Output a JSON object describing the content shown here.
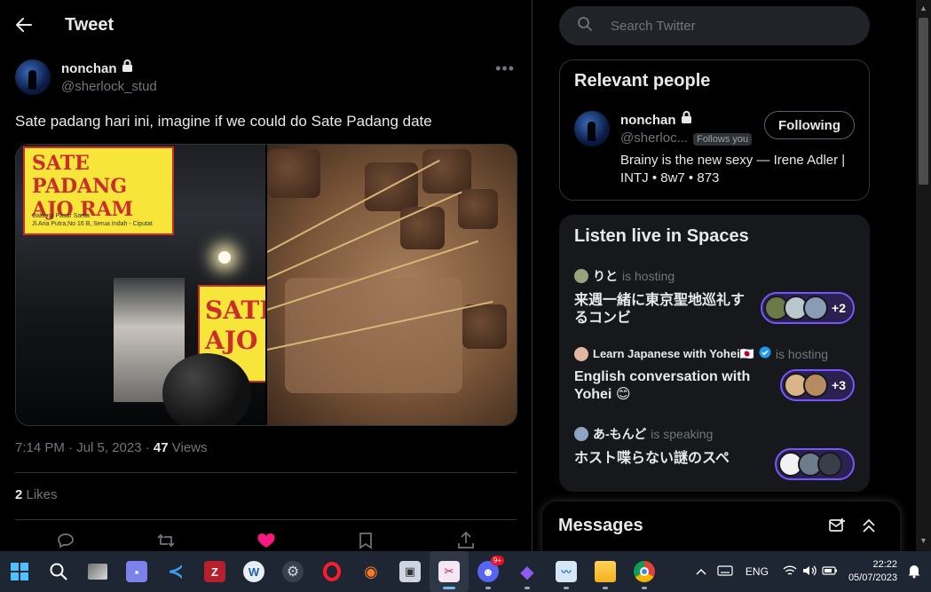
{
  "header": {
    "title": "Tweet"
  },
  "tweet": {
    "author_name": "nonchan",
    "author_handle": "@sherlock_stud",
    "text": "Sate padang hari ini, imagine if we could do Sate Padang date",
    "time": "7:14 PM · Jul 5, 2023 · ",
    "views_count": "47",
    "views_label": " Views",
    "likes_count": "2",
    "likes_label": " Likes",
    "media": [
      {
        "sign_line1": "SATE PADANG",
        "sign_line2": "AJO RAM",
        "sign_small1": "Cabang Pasar Santa",
        "sign_small2": "Jl.Aria Putra,No 16 B, Serua Indah - Ciputat",
        "sign2_text": "SATE AJO"
      },
      {}
    ]
  },
  "search": {
    "placeholder": "Search Twitter"
  },
  "relevant": {
    "title": "Relevant people",
    "name": "nonchan",
    "handle": "@sherloc...",
    "follows_you": "Follows you",
    "button": "Following",
    "bio": "Brainy is the new sexy — Irene Adler | INTJ • 8w7 • 873"
  },
  "spaces": {
    "title": "Listen live in Spaces",
    "items": [
      {
        "host": "りと",
        "role": "is hosting",
        "title": "来週一緒に東京聖地巡礼するコンビ",
        "extra": "+2"
      },
      {
        "host": "Learn Japanese with Yohei🇯🇵",
        "role": "is hosting",
        "title": "English conversation with Yohei 😊",
        "extra": "+3"
      },
      {
        "host": "あ-もんど",
        "role": "is speaking",
        "title": "ホスト喋らない謎のスペ",
        "extra": ""
      }
    ]
  },
  "messages": {
    "title": "Messages"
  },
  "taskbar": {
    "lang": "ENG",
    "time": "22:22",
    "date": "05/07/2023",
    "discord_badge": "9+"
  },
  "colors": {
    "accent": "#1d9bf0",
    "like": "#f91880",
    "spaces_border": "#7856ff"
  }
}
